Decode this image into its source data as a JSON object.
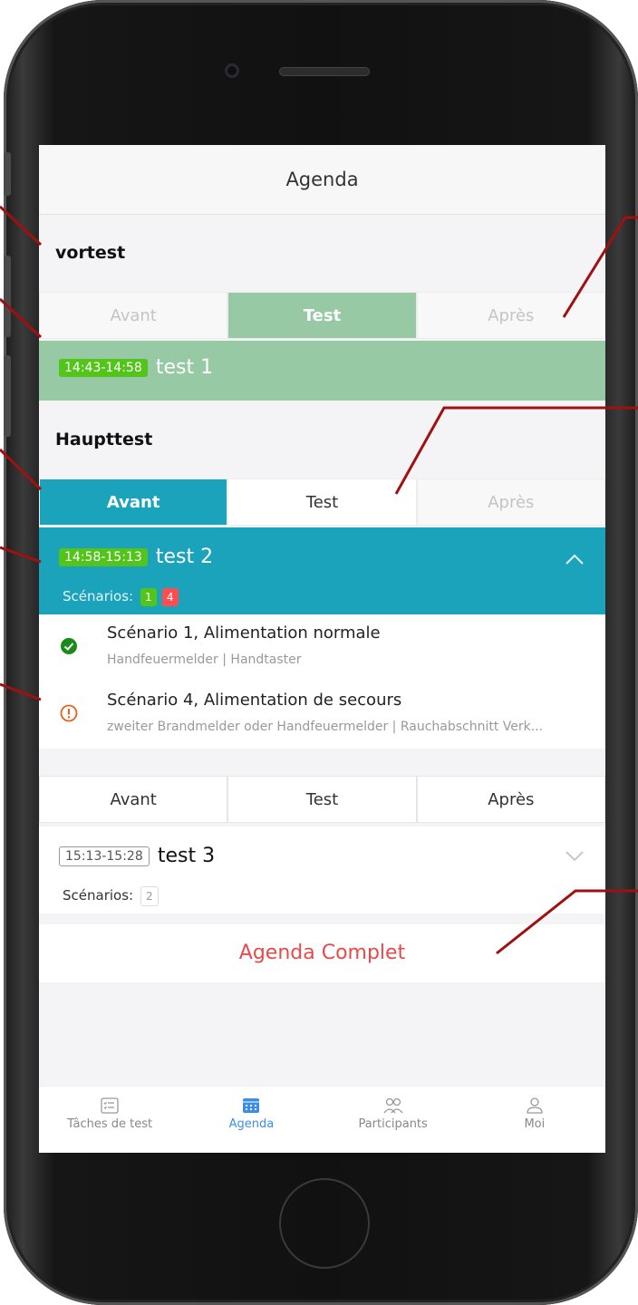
{
  "header": {
    "title": "Agenda"
  },
  "sections": [
    {
      "title": "vortest",
      "tabs": [
        "Avant",
        "Test",
        "Après"
      ],
      "item": {
        "time": "14:43-14:58",
        "name": "test 1"
      }
    },
    {
      "title": "Haupttest",
      "tabs": [
        "Avant",
        "Test",
        "Après"
      ],
      "item": {
        "time": "14:58-15:13",
        "name": "test 2",
        "scenarios_label": "Scénarios:",
        "count_ok": "1",
        "count_warn": "4",
        "scenarios": [
          {
            "title": "Scénario 1, Alimentation normale",
            "sub": "Handfeuermelder | Handtaster",
            "status": "ok"
          },
          {
            "title": "Scénario 4, Alimentation de secours",
            "sub": "zweiter Brandmelder oder Handfeuermelder | Rauchabschnitt Verk...",
            "status": "warning"
          }
        ]
      }
    },
    {
      "tabs": [
        "Avant",
        "Test",
        "Après"
      ],
      "item": {
        "time": "15:13-15:28",
        "name": "test 3",
        "scenarios_label": "Scénarios:",
        "count": "2"
      }
    }
  ],
  "complete_button": "Agenda Complet",
  "tabbar": [
    {
      "label": "Tâches de test",
      "icon": "checklist-icon"
    },
    {
      "label": "Agenda",
      "icon": "calendar-icon"
    },
    {
      "label": "Participants",
      "icon": "people-icon"
    },
    {
      "label": "Moi",
      "icon": "user-icon"
    }
  ],
  "colors": {
    "green_tab": "#96c9a4",
    "blue_active": "#1aa3bb",
    "accent_red": "#e84a4a",
    "tab_active": "#3a8ee6"
  }
}
